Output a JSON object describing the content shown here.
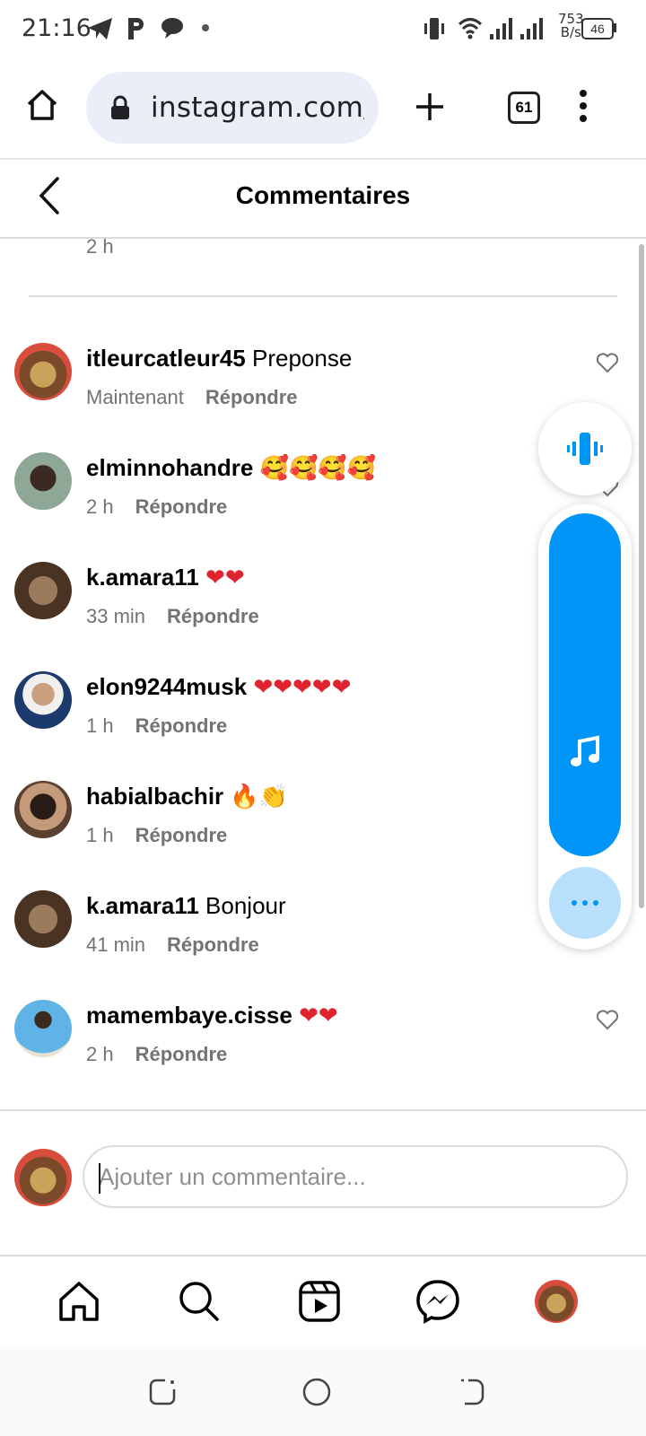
{
  "status_bar": {
    "time": "21:16",
    "net_speed_value": "753",
    "net_speed_unit": "B/s",
    "battery": "46"
  },
  "browser": {
    "url": "instagram.com/p",
    "tab_count": "61",
    "icons": [
      "home-icon",
      "lock-icon",
      "plus-icon",
      "tabs-icon",
      "more-vert-icon"
    ]
  },
  "header": {
    "title": "Commentaires"
  },
  "previous_comment_time": "2 h",
  "reply_label": "Répondre",
  "comments": [
    {
      "username": "itleurcatleur45",
      "text": "Preponse",
      "emoji": "",
      "time": "Maintenant"
    },
    {
      "username": "elminnohandre",
      "text": "",
      "emoji": "🥰🥰🥰🥰",
      "time": "2 h"
    },
    {
      "username": "k.amara11",
      "text": "",
      "emoji": "❤❤",
      "time": "33 min"
    },
    {
      "username": "elon9244musk",
      "text": "",
      "emoji": "❤❤❤❤❤",
      "time": "1 h"
    },
    {
      "username": "habialbachir",
      "text": "",
      "emoji": "🔥👏",
      "time": "1 h"
    },
    {
      "username": "k.amara11",
      "text": "Bonjour",
      "emoji": "",
      "time": "41 min"
    },
    {
      "username": "mamembaye.cisse",
      "text": "",
      "emoji": "❤❤",
      "time": "2 h"
    }
  ],
  "comment_input": {
    "placeholder": "Ajouter un commentaire..."
  },
  "bottom_nav": [
    "home-icon",
    "search-icon",
    "reels-icon",
    "messenger-icon",
    "profile-avatar"
  ],
  "colors": {
    "accent": "#0095f6",
    "accent_light": "#b8e0fc",
    "meta_gray": "#737373",
    "heart_red": "#e0242f"
  }
}
